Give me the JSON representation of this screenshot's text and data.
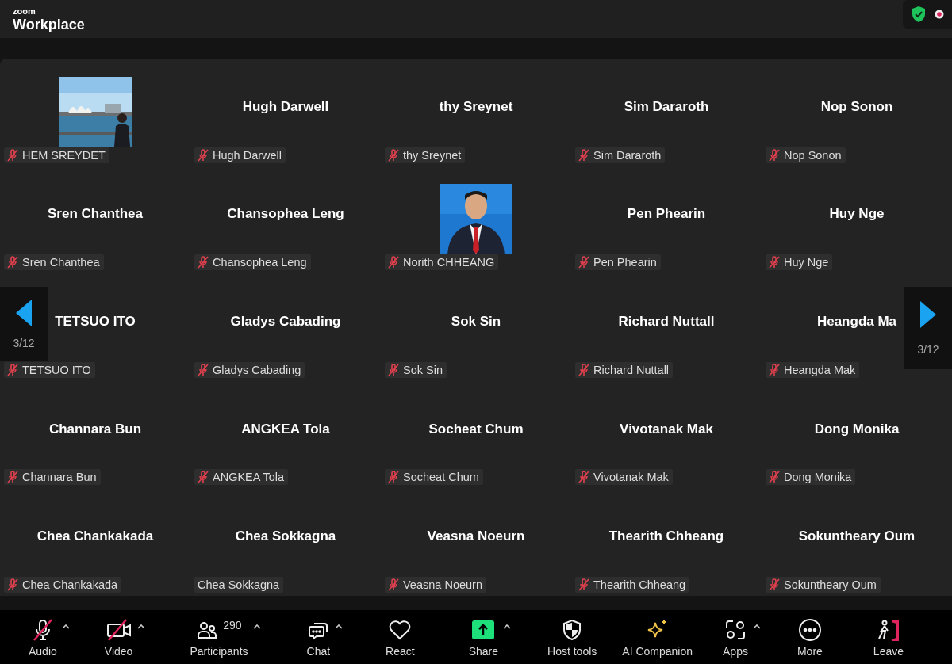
{
  "title_bar": {
    "brand_small": "zoom",
    "brand": "Workplace"
  },
  "gallery": {
    "page_left": "3/12",
    "page_right": "3/12",
    "tiles": [
      {
        "kind": "picture",
        "display_name": "HEM SREYDET",
        "muted": true
      },
      {
        "kind": "name",
        "title": "Hugh Darwell",
        "display_name": "Hugh Darwell",
        "muted": true
      },
      {
        "kind": "name",
        "title": "thy Sreynet",
        "display_name": "thy Sreynet",
        "muted": true
      },
      {
        "kind": "name",
        "title": "Sim Dararoth",
        "display_name": "Sim Dararoth",
        "muted": true
      },
      {
        "kind": "name",
        "title": "Nop Sonon",
        "display_name": "Nop Sonon",
        "muted": true
      },
      {
        "kind": "name",
        "title": "Sren Chanthea",
        "display_name": "Sren Chanthea",
        "muted": true
      },
      {
        "kind": "name",
        "title": "Chansophea Leng",
        "display_name": "Chansophea Leng",
        "muted": true
      },
      {
        "kind": "picture",
        "display_name": "Norith CHHEANG",
        "muted": true
      },
      {
        "kind": "name",
        "title": "Pen Phearin",
        "display_name": "Pen Phearin",
        "muted": true
      },
      {
        "kind": "name",
        "title": "Huy Nge",
        "display_name": "Huy Nge",
        "muted": true
      },
      {
        "kind": "name",
        "title": "TETSUO ITO",
        "display_name": "TETSUO ITO",
        "muted": true
      },
      {
        "kind": "name",
        "title": "Gladys Cabading",
        "display_name": "Gladys Cabading",
        "muted": true
      },
      {
        "kind": "name",
        "title": "Sok Sin",
        "display_name": "Sok Sin",
        "muted": true
      },
      {
        "kind": "name",
        "title": "Richard Nuttall",
        "display_name": "Richard Nuttall",
        "muted": true
      },
      {
        "kind": "name",
        "title": "Heangda Ma",
        "display_name": "Heangda Mak",
        "muted": true
      },
      {
        "kind": "name",
        "title": "Channara Bun",
        "display_name": "Channara Bun",
        "muted": true
      },
      {
        "kind": "name",
        "title": "ANGKEA Tola",
        "display_name": "ANGKEA Tola",
        "muted": true
      },
      {
        "kind": "name",
        "title": "Socheat Chum",
        "display_name": "Socheat Chum",
        "muted": true
      },
      {
        "kind": "name",
        "title": "Vivotanak Mak",
        "display_name": "Vivotanak Mak",
        "muted": true
      },
      {
        "kind": "name",
        "title": "Dong Monika",
        "display_name": "Dong Monika",
        "muted": true
      },
      {
        "kind": "name",
        "title": "Chea Chankakada",
        "display_name": "Chea Chankakada",
        "muted": true
      },
      {
        "kind": "name",
        "title": "Chea Sokkagna",
        "display_name": "Chea Sokkagna",
        "muted": false
      },
      {
        "kind": "name",
        "title": "Veasna Noeurn",
        "display_name": "Veasna Noeurn",
        "muted": true
      },
      {
        "kind": "name",
        "title": "Thearith Chheang",
        "display_name": "Thearith Chheang",
        "muted": true
      },
      {
        "kind": "name",
        "title": "Sokuntheary Oum",
        "display_name": "Sokuntheary Oum",
        "muted": true
      }
    ]
  },
  "toolbar": [
    {
      "kind": "audio",
      "label": "Audio",
      "has_menu": true
    },
    {
      "kind": "video",
      "label": "Video",
      "has_menu": true
    },
    {
      "kind": "participants",
      "label": "Participants",
      "count": "290",
      "has_menu": true
    },
    {
      "kind": "chat",
      "label": "Chat",
      "has_menu": true
    },
    {
      "kind": "react",
      "label": "React",
      "has_menu": false
    },
    {
      "kind": "share",
      "label": "Share",
      "has_menu": true
    },
    {
      "kind": "host",
      "label": "Host tools",
      "has_menu": false
    },
    {
      "kind": "ai",
      "label": "AI Companion",
      "has_menu": false
    },
    {
      "kind": "apps",
      "label": "Apps",
      "has_menu": true
    },
    {
      "kind": "more",
      "label": "More",
      "has_menu": false
    },
    {
      "kind": "leave",
      "label": "Leave",
      "has_menu": false
    }
  ]
}
